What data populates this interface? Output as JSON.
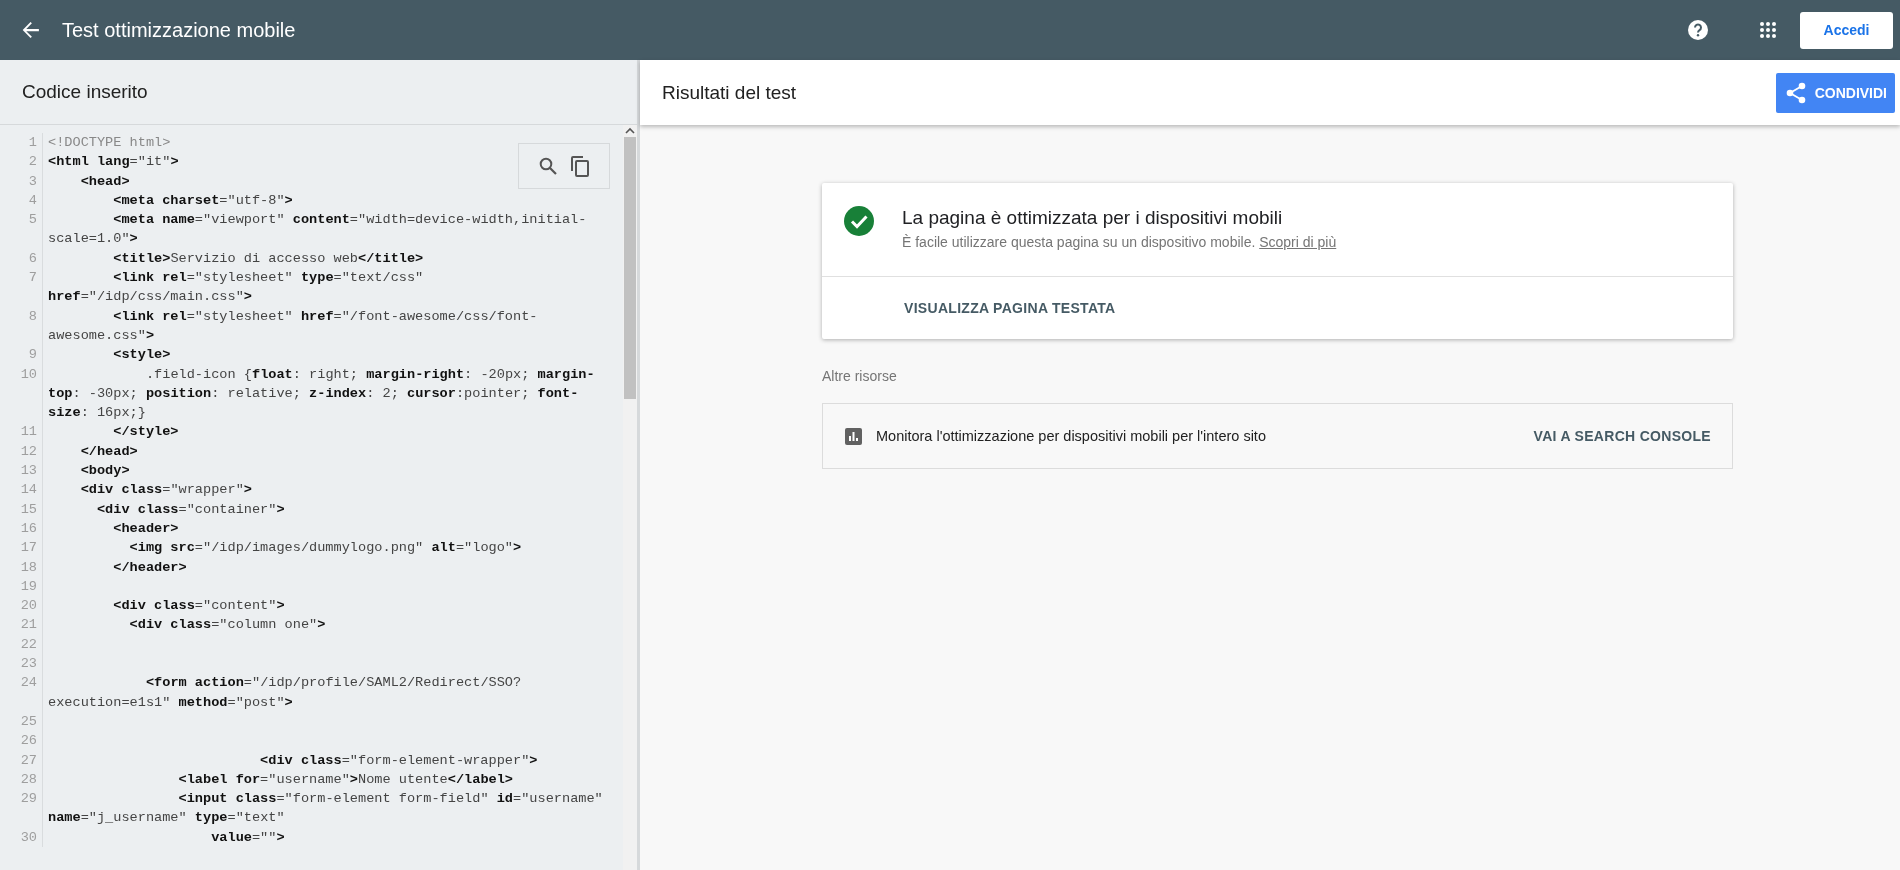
{
  "app_bar": {
    "title": "Test ottimizzazione mobile",
    "signin_button": "Accedi"
  },
  "code_panel": {
    "title": "Codice inserito",
    "lines": [
      {
        "number": "1",
        "kind": "doctype",
        "code": "<!DOCTYPE html>"
      },
      {
        "number": "2",
        "kind": "markup",
        "code": "**<html lang**=\"it\"**>**"
      },
      {
        "number": "3",
        "kind": "markup",
        "code": "    **<head>**"
      },
      {
        "number": "4",
        "kind": "markup",
        "code": "        **<meta charset**=\"utf-8\"**>**"
      },
      {
        "number": "5",
        "kind": "markup",
        "code": "        **<meta name**=\"viewport\" **content**=\"width=device-width,initial-scale=1.0\"**>**"
      },
      {
        "number": "6",
        "kind": "markup",
        "code": "        **<title>**Servizio di accesso web**</title>**"
      },
      {
        "number": "7",
        "kind": "markup",
        "code": "        **<link rel**=\"stylesheet\" **type**=\"text/css\" **href**=\"/idp/css/main.css\"**>**"
      },
      {
        "number": "8",
        "kind": "markup",
        "code": "        **<link rel**=\"stylesheet\" **href**=\"/font-awesome/css/font-awesome.css\"**>**"
      },
      {
        "number": "9",
        "kind": "markup",
        "code": "        **<style>**"
      },
      {
        "number": "10",
        "kind": "markup",
        "code": "            .field-icon {**float**: right; **margin-right**: -20px; **margin-top**: -30px; **position**: relative; **z-index**: 2; **cursor**:pointer; **font-size**: 16px;}"
      },
      {
        "number": "11",
        "kind": "markup",
        "code": "        **</style>**"
      },
      {
        "number": "12",
        "kind": "markup",
        "code": "    **</head>**"
      },
      {
        "number": "13",
        "kind": "markup",
        "code": "    **<body>**"
      },
      {
        "number": "14",
        "kind": "markup",
        "code": "    **<div class**=\"wrapper\"**>**"
      },
      {
        "number": "15",
        "kind": "markup",
        "code": "      **<div class**=\"container\"**>**"
      },
      {
        "number": "16",
        "kind": "markup",
        "code": "        **<header>**"
      },
      {
        "number": "17",
        "kind": "markup",
        "code": "          **<img src**=\"/idp/images/dummylogo.png\" **alt**=\"logo\"**>**"
      },
      {
        "number": "18",
        "kind": "markup",
        "code": "        **</header>**"
      },
      {
        "number": "19",
        "kind": "markup"
      },
      {
        "number": "20",
        "kind": "markup",
        "code": "        **<div class**=\"content\"**>**"
      },
      {
        "number": "21",
        "kind": "markup",
        "code": "          **<div class**=\"column one\"**>**"
      },
      {
        "number": "22",
        "kind": "markup"
      },
      {
        "number": "23",
        "kind": "markup"
      },
      {
        "number": "24",
        "kind": "markup",
        "code": "            **<form action**=\"/idp/profile/SAML2/Redirect/SSO?execution=e1s1\" **method**=\"post\"**>**"
      },
      {
        "number": "25",
        "kind": "markup"
      },
      {
        "number": "26",
        "kind": "markup"
      },
      {
        "number": "27",
        "kind": "markup",
        "code": "                          **<div class**=\"form-element-wrapper\"**>**"
      },
      {
        "number": "28",
        "kind": "markup",
        "code": "                **<label for**=\"username\"**>**Nome utente**</label>**"
      },
      {
        "number": "29",
        "kind": "markup",
        "code": "                **<input class**=\"form-element form-field\" **id**=\"username\" **name**=\"j_username\" **type**=\"text\""
      },
      {
        "number": "30",
        "kind": "markup",
        "code": "                    **value**=\"\"**>**"
      }
    ]
  },
  "results": {
    "title": "Risultati del test",
    "share_button": "CONDIVIDI",
    "verdict": {
      "title": "La pagina è ottimizzata per i dispositivi mobili",
      "description": "È facile utilizzare questa pagina su un dispositivo mobile.",
      "link": "Scopri di più"
    },
    "view_button": "VISUALIZZA PAGINA TESTATA",
    "resources_heading": "Altre risorse",
    "resources": [
      {
        "text": "Monitora l'ottimizzazione per dispositivi mobili per l'intero sito",
        "action": "VAI A SEARCH CONSOLE"
      }
    ]
  }
}
